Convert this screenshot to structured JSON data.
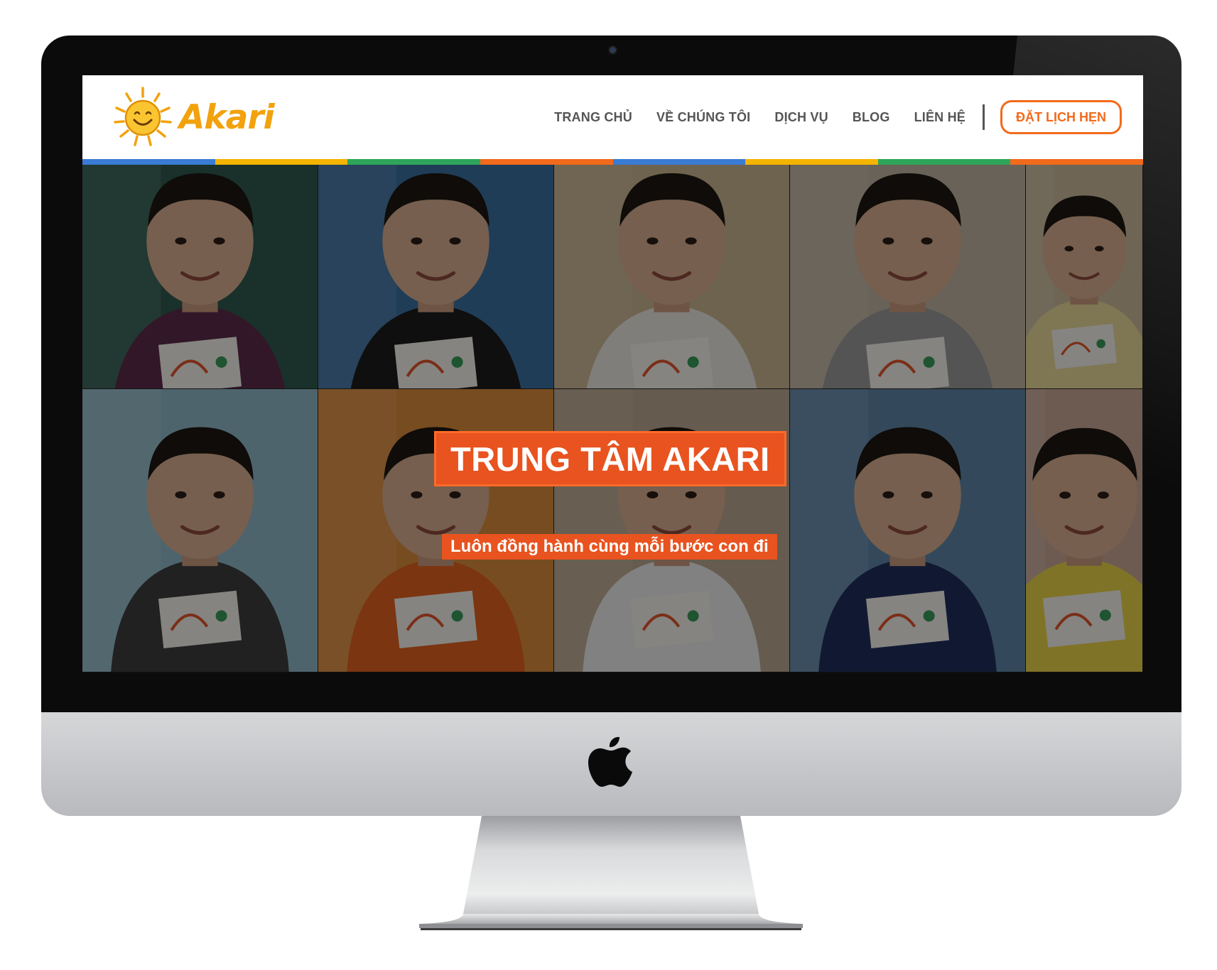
{
  "header": {
    "logo_text": "Akari",
    "nav": [
      "TRANG CHỦ",
      "VỀ CHÚNG TÔI",
      "DỊCH VỤ",
      "BLOG",
      "LIÊN HỆ"
    ],
    "cta_label": "ĐẶT LỊCH HẸN"
  },
  "color_strip": [
    "#3a7bd5",
    "#f5b400",
    "#2ea55a",
    "#f26a1b",
    "#3a7bd5",
    "#f5b400",
    "#2ea55a",
    "#f26a1b"
  ],
  "hero": {
    "title": "TRUNG TÂM AKARI",
    "subtitle": "Luôn đồng hành cùng mỗi bước con đi",
    "photo_grid": [
      {
        "name": "photo-child-1",
        "bg": "#2f5a4e",
        "shirt": "#5c2a4a"
      },
      {
        "name": "photo-child-2",
        "bg": "#3b6fa0",
        "shirt": "#1d1d1d"
      },
      {
        "name": "photo-child-3",
        "bg": "#c9b48e",
        "shirt": "#e9e6e1"
      },
      {
        "name": "photo-child-4",
        "bg": "#bfb3a0",
        "shirt": "#9a9a9a"
      },
      {
        "name": "photo-child-5",
        "bg": "#c8b89c",
        "shirt": "#e8d89a"
      },
      {
        "name": "photo-child-6",
        "bg": "#8fb7c7",
        "shirt": "#3d3d3d"
      },
      {
        "name": "photo-child-7",
        "bg": "#d98a3b",
        "shirt": "#e0621e"
      },
      {
        "name": "photo-child-8",
        "bg": "#b9a68e",
        "shirt": "#ececec"
      },
      {
        "name": "photo-child-9",
        "bg": "#5e86a6",
        "shirt": "#1f2f5c"
      },
      {
        "name": "photo-child-10",
        "bg": "#c7a696",
        "shirt": "#e8d24a"
      }
    ]
  },
  "colors": {
    "brand_orange": "#f26a1b",
    "logo_yellow": "#f2a20d",
    "nav_text": "#555555"
  }
}
